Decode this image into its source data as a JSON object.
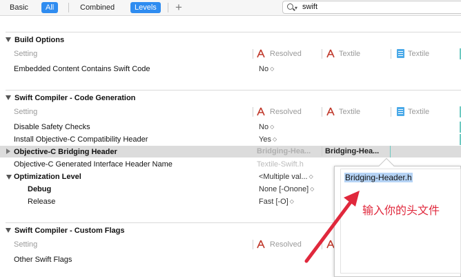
{
  "toolbar": {
    "basic": "Basic",
    "all": "All",
    "combined": "Combined",
    "levels": "Levels",
    "add": "+",
    "search_value": "swift"
  },
  "columns": {
    "setting": "Setting",
    "resolved": "Resolved",
    "textile_target": "Textile",
    "textile_project": "Textile"
  },
  "sections": {
    "build_options": {
      "title": "Build Options",
      "rows": [
        {
          "label": "Embedded Content Contains Swift Code",
          "value": "No"
        }
      ]
    },
    "code_generation": {
      "title": "Swift Compiler - Code Generation",
      "rows": [
        {
          "label": "Disable Safety Checks",
          "value": "No"
        },
        {
          "label": "Install Objective-C Compatibility Header",
          "value": "Yes"
        },
        {
          "label": "Objective-C Bridging Header",
          "resolved": "Bridging-Hea...",
          "textile": "Bridging-Hea..."
        },
        {
          "label": "Objective-C Generated Interface Header Name",
          "value": "Textile-Swift.h"
        },
        {
          "label": "Optimization Level",
          "value": "<Multiple val..."
        },
        {
          "label": "Debug",
          "value": "None [-Onone]"
        },
        {
          "label": "Release",
          "value": "Fast [-O]"
        }
      ]
    },
    "custom_flags": {
      "title": "Swift Compiler - Custom Flags",
      "rows": [
        {
          "label": "Other Swift Flags",
          "value": ""
        }
      ]
    }
  },
  "popover": {
    "text": "Bridging-Header.h"
  },
  "annotation": {
    "note": "输入你的头文件",
    "color": "#e0283c"
  },
  "colors": {
    "accent": "#2f8cf0",
    "edge": "#6cc9c0"
  }
}
